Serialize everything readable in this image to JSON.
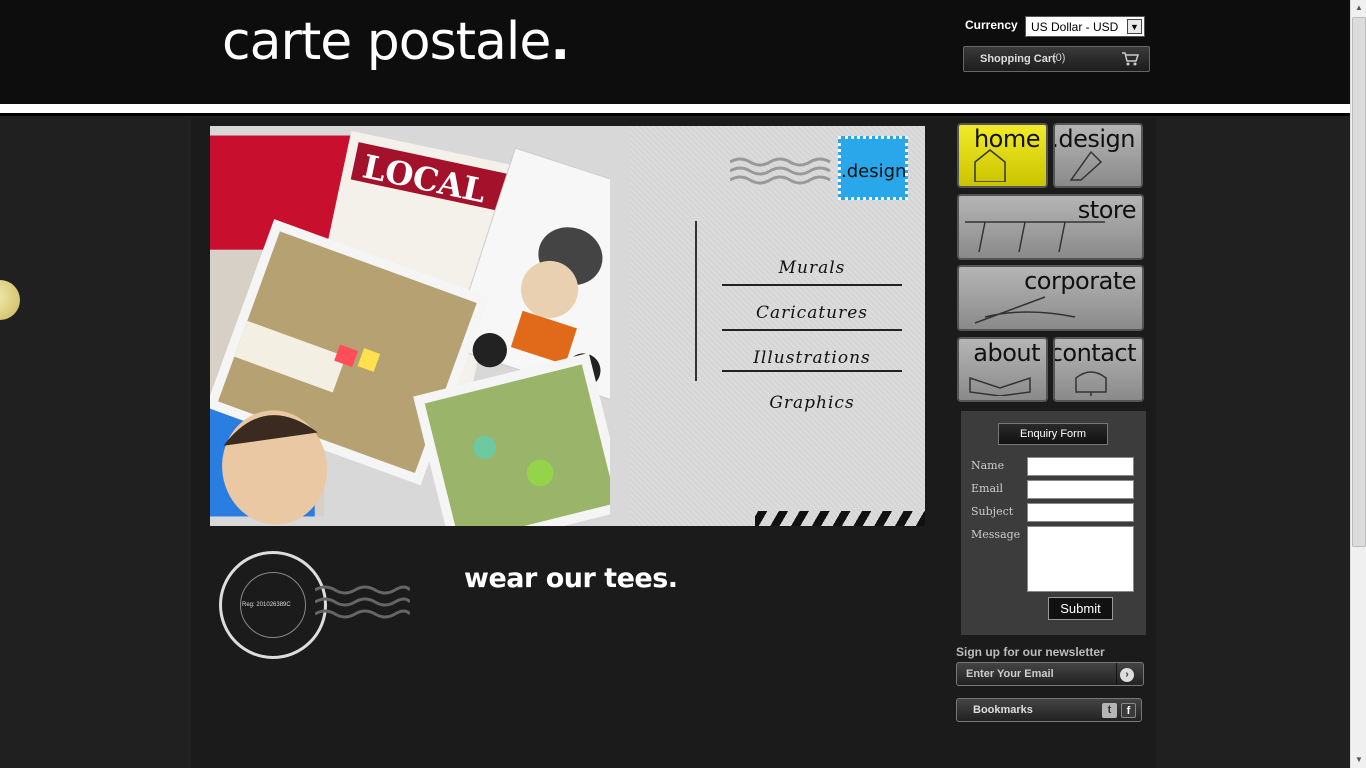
{
  "header": {
    "logo_text": "carte postale",
    "logo_dot": ".",
    "currency_label": "Currency",
    "currency_selected": "US Dollar - USD",
    "cart_label": "Shopping Cart",
    "cart_count": "(0)"
  },
  "hero": {
    "stamp_text": ".design",
    "menu": [
      "Murals",
      "Caricatures",
      "Illustrations",
      "Graphics"
    ]
  },
  "seal": {
    "reg_text": "Reg: 201026389C"
  },
  "tagline": "wear our tees.",
  "nav": {
    "home": "home",
    "design": ".design",
    "store": "store",
    "corporate": "corporate",
    "about": "about",
    "contact": "contact"
  },
  "enquiry": {
    "title": "Enquiry Form",
    "name_label": "Name",
    "email_label": "Email",
    "subject_label": "Subject",
    "message_label": "Message",
    "submit_label": "Submit"
  },
  "newsletter": {
    "label": "Sign up for our newsletter",
    "placeholder": "Enter Your Email"
  },
  "bookmarks": {
    "label": "Bookmarks"
  },
  "icons": {
    "cart": "shopping-cart-icon",
    "newsletter_go": "arrow-right-icon",
    "twitter": "twitter-icon",
    "facebook": "facebook-icon"
  },
  "colors": {
    "home_tile": "#e8e000",
    "stamp": "#2aa7ea",
    "background": "#202020"
  }
}
